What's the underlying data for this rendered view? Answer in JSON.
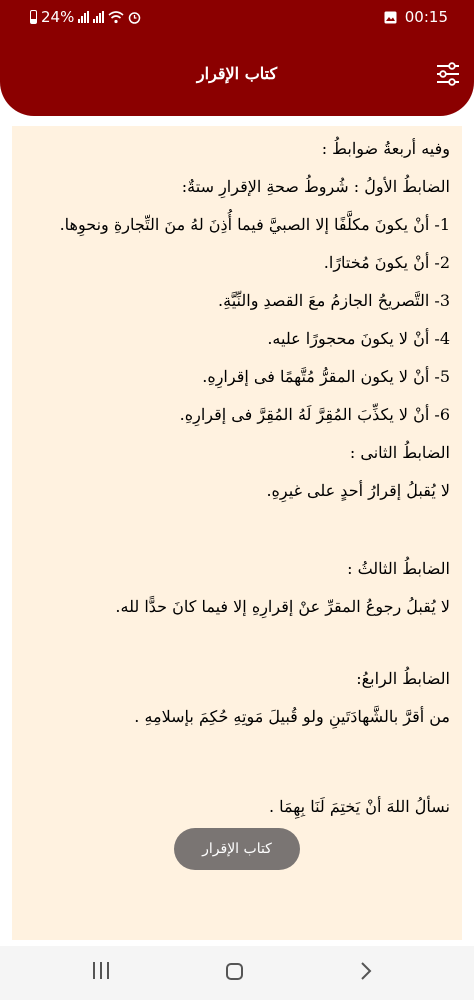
{
  "status": {
    "battery": "24%",
    "time": "00:15"
  },
  "header": {
    "title": "كتاب الإقرار"
  },
  "content": {
    "intro": "وفيه أربعةُ ضوابطُ :",
    "rule1_title": "الضابطُ الأولُ : شُروطُ صحةِ الإقرارِ ستةٌ:",
    "rule1_items": [
      "1- أنْ يكونَ مكلَّفًا إلا الصبيَّ فيما أُذِنَ لهُ منَ التِّجارةِ ونحوِها.",
      "2- أنْ يكونَ مُختارًا.",
      "3- التَّصريحُ الجازمُ معَ القصدِ والنِّيَّةِ.",
      "4- أنْ لا يكونَ محجورًا عليه.",
      "5- أنْ لا يكون المقرُّ مُتَّهمًا فى إقرارِهِ.",
      "6- أنْ لا يكذِّبَ المُقِرَّ لَهُ المُقِرَّ فى إقرارِهِ."
    ],
    "rule2_title": "الضابطُ الثانى :",
    "rule2_text": "لا يُقبلُ إقرارُ أحدٍ على غيرِهِ.",
    "rule3_title": "الضابطُ الثالثُ :",
    "rule3_text": "لا يُقبلُ رجوعُ المقرِّ عنْ إقرارِهِ إلا فيما كانَ حدًّا لله.",
    "rule4_title": "الضابطُ الرابعُ:",
    "rule4_text": "من أقرَّ بالشَّهادَتَينِ ولو قُبيلَ مَوتِهِ حُكِمَ بإسلامِهِ .",
    "closing": "نسألُ اللهَ أنْ يَختِمَ لَنَا بِهِمَا ."
  },
  "toast": {
    "label": "كتاب الإقرار"
  },
  "icons": {
    "menu": "sliders-icon",
    "status_left": [
      "battery-icon",
      "signal-icon",
      "wifi-icon",
      "alarm-icon"
    ],
    "status_right": [
      "image-notification-icon"
    ],
    "nav": [
      "recents-icon",
      "home-icon",
      "back-icon"
    ]
  },
  "colors": {
    "primary": "#8b0000",
    "panel": "#fff2e0",
    "toast": "#7a7573"
  }
}
